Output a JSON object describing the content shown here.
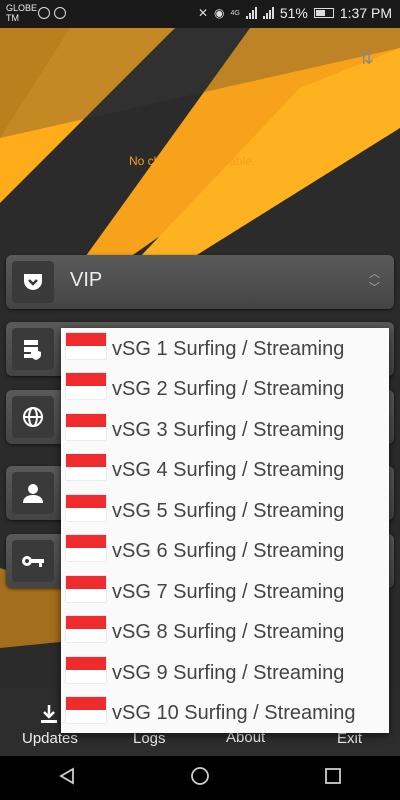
{
  "status_bar": {
    "carrier": "GLOBE TM",
    "network_type": "4G",
    "battery_percent": "51%",
    "time": "1:37 PM"
  },
  "chart": {
    "empty_message": "No chart data available."
  },
  "selector": {
    "selected": "VIP"
  },
  "server_list": {
    "items": [
      {
        "label": "vSG 1 Surfing / Streaming",
        "flag": "singapore-flag"
      },
      {
        "label": "vSG 2 Surfing / Streaming",
        "flag": "singapore-flag"
      },
      {
        "label": "vSG 3 Surfing / Streaming",
        "flag": "singapore-flag"
      },
      {
        "label": "vSG 4 Surfing / Streaming",
        "flag": "singapore-flag"
      },
      {
        "label": "vSG 5 Surfing / Streaming",
        "flag": "singapore-flag"
      },
      {
        "label": "vSG 6 Surfing / Streaming",
        "flag": "singapore-flag"
      },
      {
        "label": "vSG 7 Surfing / Streaming",
        "flag": "singapore-flag"
      },
      {
        "label": "vSG 8 Surfing / Streaming",
        "flag": "singapore-flag"
      },
      {
        "label": "vSG 9 Surfing / Streaming",
        "flag": "singapore-flag"
      },
      {
        "label": "vSG 10 Surfing / Streaming",
        "flag": "singapore-flag"
      }
    ]
  },
  "bottom_bar": {
    "updates": "Updates",
    "logs": "Logs",
    "about": "About",
    "exit": "Exit"
  },
  "colors": {
    "accent": "#f5a11a",
    "flag_red": "#ef2b2d"
  }
}
